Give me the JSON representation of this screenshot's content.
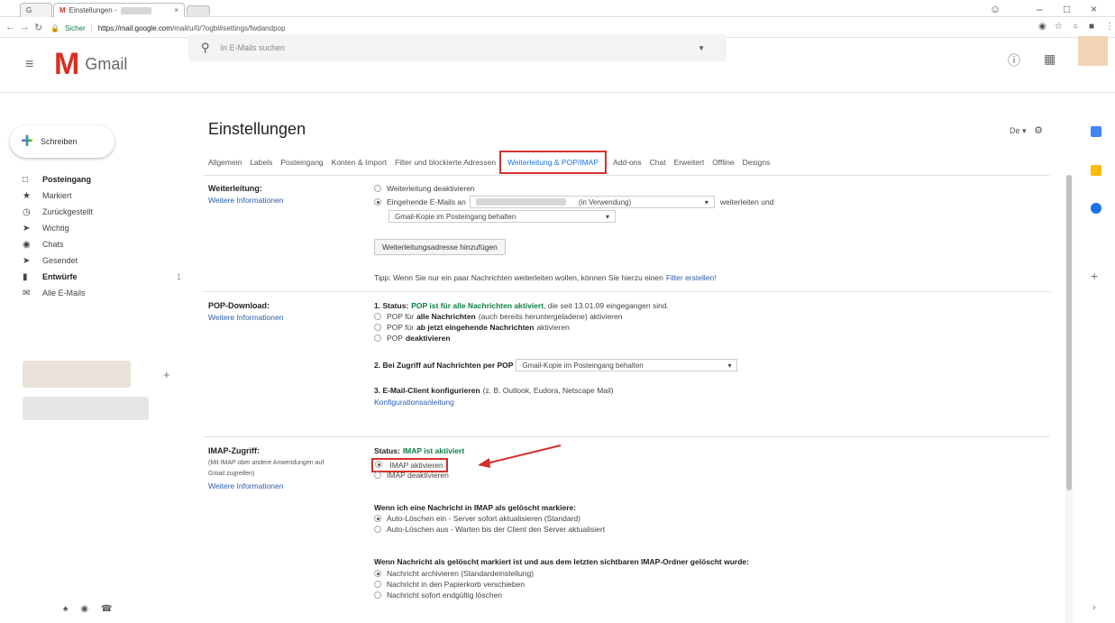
{
  "browser": {
    "tab_prev_label": "G",
    "tab_title": "Einstellungen -",
    "tab_close": "×",
    "url_secure": "Sicher",
    "url_host": "https://mail.google.com",
    "url_path": "/mail/u/0/?ogbl#settings/fwdandpop"
  },
  "header": {
    "brand": "Gmail",
    "search_placeholder": "In E-Mails suchen"
  },
  "compose": {
    "label": "Schreiben"
  },
  "nav": {
    "items": [
      {
        "label": "Posteingang",
        "icon": "inbox-icon",
        "bold": true,
        "count": ""
      },
      {
        "label": "Markiert",
        "icon": "star-icon",
        "bold": false,
        "count": ""
      },
      {
        "label": "Zurückgestellt",
        "icon": "clock-icon",
        "bold": false,
        "count": ""
      },
      {
        "label": "Wichtig",
        "icon": "label-important-icon",
        "bold": false,
        "count": ""
      },
      {
        "label": "Chats",
        "icon": "chat-icon",
        "bold": false,
        "count": ""
      },
      {
        "label": "Gesendet",
        "icon": "send-icon",
        "bold": false,
        "count": ""
      },
      {
        "label": "Entwürfe",
        "icon": "draft-icon",
        "bold": true,
        "count": "1"
      },
      {
        "label": "Alle E-Mails",
        "icon": "mail-icon",
        "bold": false,
        "count": ""
      }
    ]
  },
  "settings": {
    "title": "Einstellungen",
    "lang": "De",
    "tabs": [
      {
        "label": "Allgemein",
        "active": false
      },
      {
        "label": "Labels",
        "active": false
      },
      {
        "label": "Posteingang",
        "active": false
      },
      {
        "label": "Konten & Import",
        "active": false
      },
      {
        "label": "Filter und blockierte Adressen",
        "active": false
      },
      {
        "label": "Weiterleitung & POP/IMAP",
        "active": true
      },
      {
        "label": "Add-ons",
        "active": false
      },
      {
        "label": "Chat",
        "active": false
      },
      {
        "label": "Erweitert",
        "active": false
      },
      {
        "label": "Offline",
        "active": false
      },
      {
        "label": "Designs",
        "active": false
      }
    ],
    "forwarding": {
      "title": "Weiterleitung:",
      "more": "Weitere Informationen",
      "opt_disable": "Weiterleitung deaktivieren",
      "opt_forward_prefix": "Eingehende E-Mails an",
      "in_use": "(in Verwendung)",
      "forward_suffix": "weiterleiten und",
      "keep_copy": "Gmail-Kopie im Posteingang behalten",
      "add_button": "Weiterleitungsadresse hinzufügen",
      "tip_prefix": "Tipp: Wenn Sie nur ein paar Nachrichten weiterleiten wollen, können Sie hierzu einen",
      "tip_link": "Filter erstellen!"
    },
    "pop": {
      "title": "POP-Download:",
      "more": "Weitere Informationen",
      "status_prefix": "1. Status:",
      "status_value": "POP ist für alle Nachrichten aktiviert",
      "status_suffix": ", die seit 13.01.09 eingegangen sind.",
      "opt1_pre": "POP für",
      "opt1_bold": "alle Nachrichten",
      "opt1_post": "(auch bereits heruntergeladene) aktivieren",
      "opt2_pre": "POP für",
      "opt2_bold": "ab jetzt eingehende Nachrichten",
      "opt2_post": "aktivieren",
      "opt3_pre": "POP",
      "opt3_bold": "deaktivieren",
      "access_label": "2. Bei Zugriff auf Nachrichten per POP",
      "access_select": "Gmail-Kopie im Posteingang behalten",
      "client_label": "3. E-Mail-Client konfigurieren",
      "client_note": "(z. B. Outlook, Eudora, Netscape Mail)",
      "client_link": "Konfigurationsanleitung"
    },
    "imap": {
      "title": "IMAP-Zugriff:",
      "sub1": "(Mit IMAP über andere Anwendungen auf",
      "sub2": "Gmail zugreifen)",
      "more": "Weitere Informationen",
      "status_label": "Status:",
      "status_value": "IMAP ist aktiviert",
      "enable": "IMAP aktivieren",
      "disable": "IMAP deaktivieren",
      "delete_heading": "Wenn ich eine Nachricht in IMAP als gelöscht markiere:",
      "delete_opt1": "Auto-Löschen ein - Server sofort aktualisieren (Standard)",
      "delete_opt2": "Auto-Löschen aus - Warten bis der Client den Server aktualisiert",
      "expunge_heading": "Wenn Nachricht als gelöscht markiert ist und aus dem letzten sichtbaren IMAP-Ordner gelöscht wurde:",
      "expunge_opt1": "Nachricht archivieren (Standardeinstellung)",
      "expunge_opt2": "Nachricht in den Papierkorb verschieben",
      "expunge_opt3": "Nachricht sofort endgültig löschen"
    }
  },
  "colors": {
    "gmail_red": "#d93025",
    "highlight_red": "#d32f2f",
    "status_green": "#0b8043",
    "link_blue": "#2a5db0",
    "active_tab_blue": "#1a73e8"
  }
}
